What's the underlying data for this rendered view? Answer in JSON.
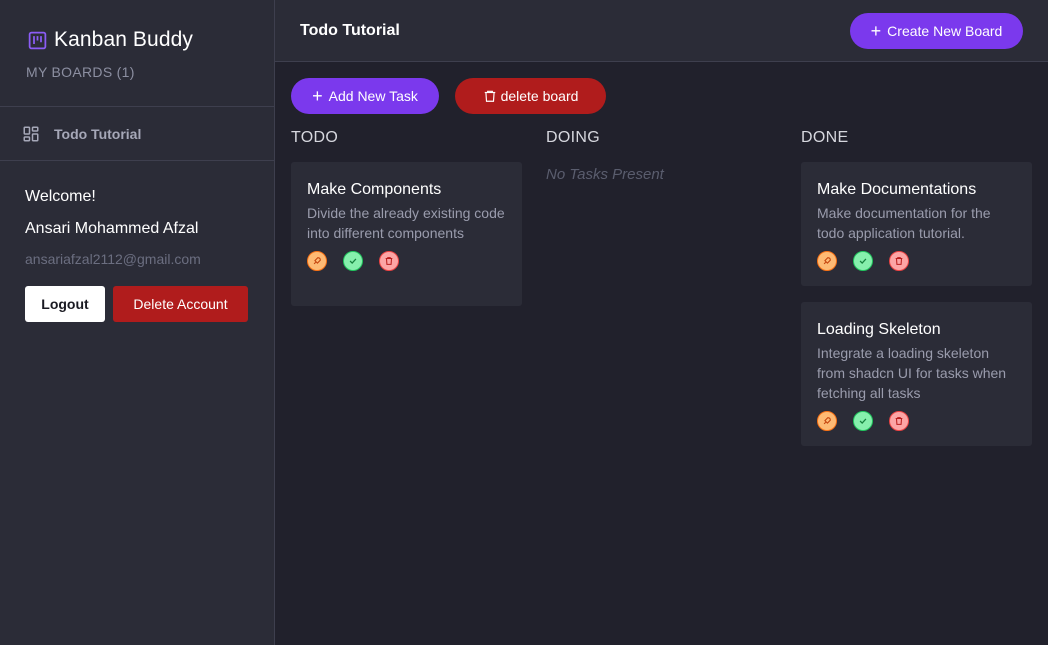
{
  "sidebar": {
    "brand_title": "Kanban Buddy",
    "boards_count": "MY BOARDS (1)",
    "boards": [
      {
        "label": "Todo Tutorial",
        "icon": "board-grid-icon"
      }
    ],
    "welcome": "Welcome!",
    "user_name": "Ansari Mohammed Afzal",
    "user_email": "ansariafzal2112@gmail.com",
    "logout_label": "Logout",
    "delete_account_label": "Delete Account"
  },
  "header": {
    "board_title": "Todo Tutorial",
    "create_board_label": "Create New Board"
  },
  "actions": {
    "add_task_label": "Add New Task",
    "delete_board_label": "delete board"
  },
  "columns": [
    {
      "title": "TODO",
      "tasks": [
        {
          "title": "Make Components",
          "description": "Divide the already existing code into different components"
        }
      ]
    },
    {
      "title": "DOING",
      "empty_text": "No Tasks Present",
      "tasks": []
    },
    {
      "title": "DONE",
      "tasks": [
        {
          "title": "Make Documentations",
          "description": "Make documentation for the todo application tutorial."
        },
        {
          "title": "Loading Skeleton",
          "description": "Integrate a loading skeleton from shadcn UI for tasks when fetching all tasks"
        }
      ]
    }
  ],
  "task_icons": [
    "rocket-icon",
    "check-icon",
    "trash-icon"
  ],
  "colors": {
    "accent": "#7b39ed",
    "danger": "#b01c1c",
    "background": "#21212c",
    "panel": "#2b2c37"
  }
}
